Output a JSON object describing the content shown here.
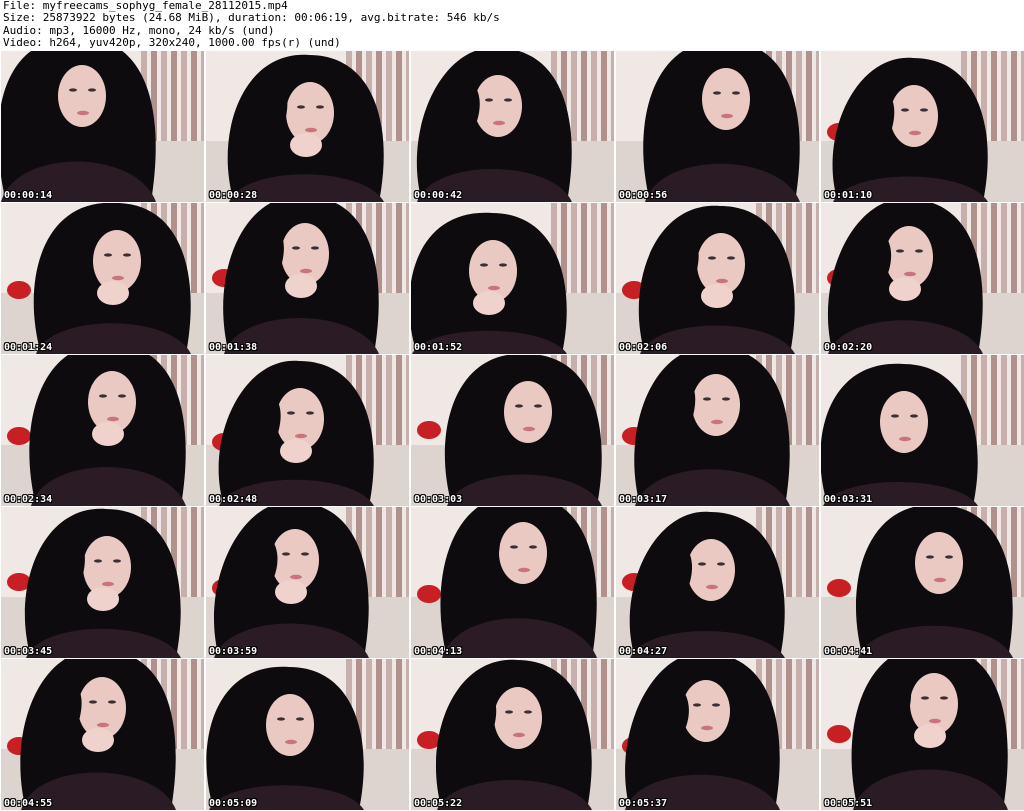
{
  "header": {
    "file_line": "File: myfreecams_sophyg_female_28112015.mp4",
    "size_line": "Size: 25873922 bytes (24.68 MiB), duration: 00:06:19, avg.bitrate: 546 kb/s",
    "audio_line": "Audio: mp3, 16000 Hz, mono, 24 kb/s (und)",
    "video_line": "Video: h264, yuv420p, 320x240, 1000.00 fps(r) (und)"
  },
  "colors": {
    "background": "#ffffff",
    "hair": "#0d0b0e",
    "skin": "#e9c9c2",
    "curtain": "#a5817c",
    "wall": "#efe8e5",
    "top": "#2a1b24",
    "pillow_red": "#c81f24",
    "timestamp": "#ffffff"
  },
  "thumbnails": [
    {
      "timestamp": "00:00:14"
    },
    {
      "timestamp": "00:00:28"
    },
    {
      "timestamp": "00:00:42"
    },
    {
      "timestamp": "00:00:56"
    },
    {
      "timestamp": "00:01:10"
    },
    {
      "timestamp": "00:01:24"
    },
    {
      "timestamp": "00:01:38"
    },
    {
      "timestamp": "00:01:52"
    },
    {
      "timestamp": "00:02:06"
    },
    {
      "timestamp": "00:02:20"
    },
    {
      "timestamp": "00:02:34"
    },
    {
      "timestamp": "00:02:48"
    },
    {
      "timestamp": "00:03:03"
    },
    {
      "timestamp": "00:03:17"
    },
    {
      "timestamp": "00:03:31"
    },
    {
      "timestamp": "00:03:45"
    },
    {
      "timestamp": "00:03:59"
    },
    {
      "timestamp": "00:04:13"
    },
    {
      "timestamp": "00:04:27"
    },
    {
      "timestamp": "00:04:41"
    },
    {
      "timestamp": "00:04:55"
    },
    {
      "timestamp": "00:05:09"
    },
    {
      "timestamp": "00:05:22"
    },
    {
      "timestamp": "00:05:37"
    },
    {
      "timestamp": "00:05:51"
    }
  ]
}
